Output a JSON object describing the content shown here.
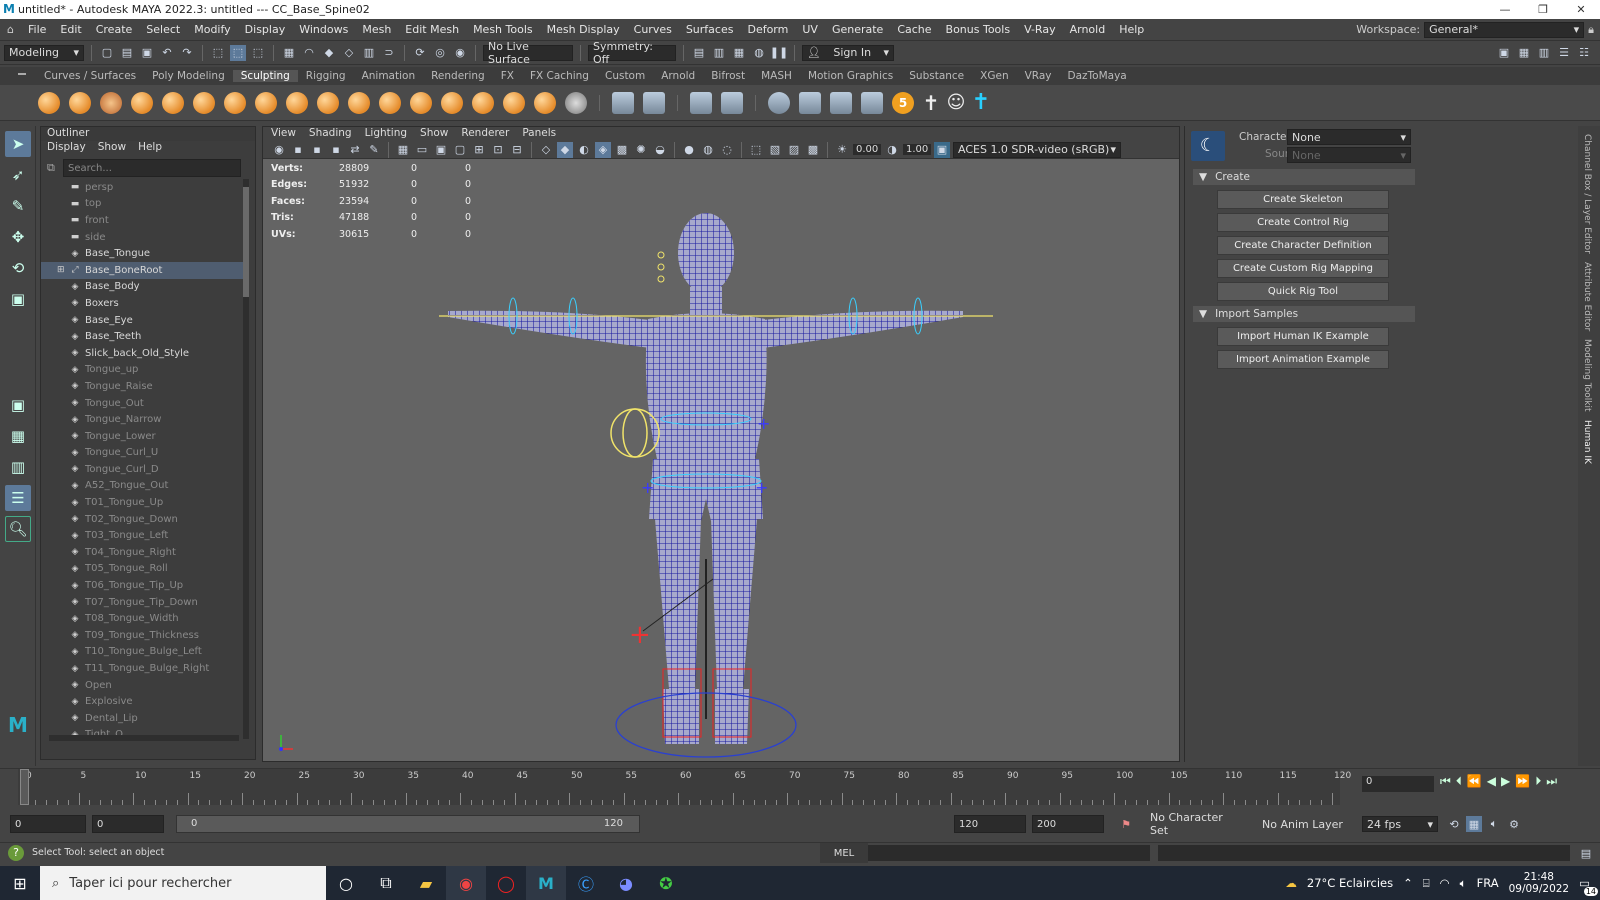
{
  "window": {
    "title": "untitled* - Autodesk MAYA 2022.3: untitled   ---   CC_Base_Spine02",
    "controls": [
      "—",
      "❐",
      "✕"
    ]
  },
  "menubar": {
    "items": [
      "File",
      "Edit",
      "Create",
      "Select",
      "Modify",
      "Display",
      "Windows",
      "Mesh",
      "Edit Mesh",
      "Mesh Tools",
      "Mesh Display",
      "Curves",
      "Surfaces",
      "Deform",
      "UV",
      "Generate",
      "Cache",
      "Bonus Tools",
      "V-Ray",
      "Arnold",
      "Help"
    ],
    "workspace_label": "Workspace:",
    "workspace_value": "General*"
  },
  "statusline": {
    "menu_set": "Modeling",
    "live_surface": "No Live Surface",
    "symmetry": "Symmetry: Off",
    "signin": "Sign In"
  },
  "shelf": {
    "tabs": [
      "Curves / Surfaces",
      "Poly Modeling",
      "Sculpting",
      "Rigging",
      "Animation",
      "Rendering",
      "FX",
      "FX Caching",
      "Custom",
      "Arnold",
      "Bifrost",
      "MASH",
      "Motion Graphics",
      "Substance",
      "XGen",
      "VRay",
      "DazToMaya"
    ],
    "active_tab": "Sculpting"
  },
  "outliner": {
    "title": "Outliner",
    "menu": [
      "Display",
      "Show",
      "Help"
    ],
    "search_placeholder": "Search...",
    "rows": [
      {
        "name": "persp",
        "icon": "camera-icon",
        "dim": true
      },
      {
        "name": "top",
        "icon": "camera-icon",
        "dim": true
      },
      {
        "name": "front",
        "icon": "camera-icon",
        "dim": true
      },
      {
        "name": "side",
        "icon": "camera-icon",
        "dim": true
      },
      {
        "name": "Base_Tongue",
        "icon": "mesh-icon",
        "dim": false
      },
      {
        "name": "Base_BoneRoot",
        "icon": "joint-icon",
        "dim": false,
        "selected": true
      },
      {
        "name": "Base_Body",
        "icon": "mesh-icon",
        "dim": false
      },
      {
        "name": "Boxers",
        "icon": "mesh-icon",
        "dim": false
      },
      {
        "name": "Base_Eye",
        "icon": "mesh-icon",
        "dim": false
      },
      {
        "name": "Base_Teeth",
        "icon": "mesh-icon",
        "dim": false
      },
      {
        "name": "Slick_back_Old_Style",
        "icon": "mesh-icon",
        "dim": false
      },
      {
        "name": "Tongue_up",
        "icon": "mesh-icon",
        "dim": true
      },
      {
        "name": "Tongue_Raise",
        "icon": "mesh-icon",
        "dim": true
      },
      {
        "name": "Tongue_Out",
        "icon": "mesh-icon",
        "dim": true
      },
      {
        "name": "Tongue_Narrow",
        "icon": "mesh-icon",
        "dim": true
      },
      {
        "name": "Tongue_Lower",
        "icon": "mesh-icon",
        "dim": true
      },
      {
        "name": "Tongue_Curl_U",
        "icon": "mesh-icon",
        "dim": true
      },
      {
        "name": "Tongue_Curl_D",
        "icon": "mesh-icon",
        "dim": true
      },
      {
        "name": "A52_Tongue_Out",
        "icon": "mesh-icon",
        "dim": true
      },
      {
        "name": "T01_Tongue_Up",
        "icon": "mesh-icon",
        "dim": true
      },
      {
        "name": "T02_Tongue_Down",
        "icon": "mesh-icon",
        "dim": true
      },
      {
        "name": "T03_Tongue_Left",
        "icon": "mesh-icon",
        "dim": true
      },
      {
        "name": "T04_Tongue_Right",
        "icon": "mesh-icon",
        "dim": true
      },
      {
        "name": "T05_Tongue_Roll",
        "icon": "mesh-icon",
        "dim": true
      },
      {
        "name": "T06_Tongue_Tip_Up",
        "icon": "mesh-icon",
        "dim": true
      },
      {
        "name": "T07_Tongue_Tip_Down",
        "icon": "mesh-icon",
        "dim": true
      },
      {
        "name": "T08_Tongue_Width",
        "icon": "mesh-icon",
        "dim": true
      },
      {
        "name": "T09_Tongue_Thickness",
        "icon": "mesh-icon",
        "dim": true
      },
      {
        "name": "T10_Tongue_Bulge_Left",
        "icon": "mesh-icon",
        "dim": true
      },
      {
        "name": "T11_Tongue_Bulge_Right",
        "icon": "mesh-icon",
        "dim": true
      },
      {
        "name": "Open",
        "icon": "mesh-icon",
        "dim": true
      },
      {
        "name": "Explosive",
        "icon": "mesh-icon",
        "dim": true
      },
      {
        "name": "Dental_Lip",
        "icon": "mesh-icon",
        "dim": true
      },
      {
        "name": "Tight_O",
        "icon": "mesh-icon",
        "dim": true
      }
    ]
  },
  "viewport": {
    "menu": [
      "View",
      "Shading",
      "Lighting",
      "Show",
      "Renderer",
      "Panels"
    ],
    "exposure": "0.00",
    "gamma": "1.00",
    "colorspace": "ACES 1.0 SDR-video (sRGB)",
    "hud": [
      {
        "label": "Verts:",
        "v": "28809",
        "a": "0",
        "b": "0"
      },
      {
        "label": "Edges:",
        "v": "51932",
        "a": "0",
        "b": "0"
      },
      {
        "label": "Faces:",
        "v": "23594",
        "a": "0",
        "b": "0"
      },
      {
        "label": "Tris:",
        "v": "47188",
        "a": "0",
        "b": "0"
      },
      {
        "label": "UVs:",
        "v": "30615",
        "a": "0",
        "b": "0"
      }
    ]
  },
  "hik": {
    "character_label": "Character:",
    "character_value": "None",
    "source_label": "Source:",
    "source_value": "None",
    "create_section": "Create",
    "create_buttons": [
      "Create Skeleton",
      "Create Control Rig",
      "Create Character Definition",
      "Create Custom Rig Mapping",
      "Quick Rig Tool"
    ],
    "import_section": "Import Samples",
    "import_buttons": [
      "Import Human IK Example",
      "Import Animation Example"
    ]
  },
  "side_tabs": [
    "Channel Box / Layer Editor",
    "Attribute Editor",
    "Modeling Toolkit",
    "Human IK"
  ],
  "timeslider": {
    "ticks": [
      "0",
      "5",
      "10",
      "15",
      "20",
      "25",
      "30",
      "35",
      "40",
      "45",
      "50",
      "55",
      "60",
      "65",
      "70",
      "75",
      "80",
      "85",
      "90",
      "95",
      "100",
      "105",
      "110",
      "115",
      "120"
    ],
    "current_frame": "0"
  },
  "range": {
    "start": "0",
    "inner_start": "0",
    "slider_start": "0",
    "slider_end": "120",
    "end": "120",
    "outer_end": "200",
    "character_set": "No Character Set",
    "anim_layer": "No Anim Layer",
    "fps": "24 fps"
  },
  "cmdline": {
    "help": "Select Tool: select an object",
    "lang": "MEL"
  },
  "taskbar": {
    "search_placeholder": "Taper ici pour rechercher",
    "weather": "27°C  Eclaircies",
    "lang": "FRA",
    "time": "21:48",
    "date": "09/09/2022",
    "notifications": "14"
  }
}
